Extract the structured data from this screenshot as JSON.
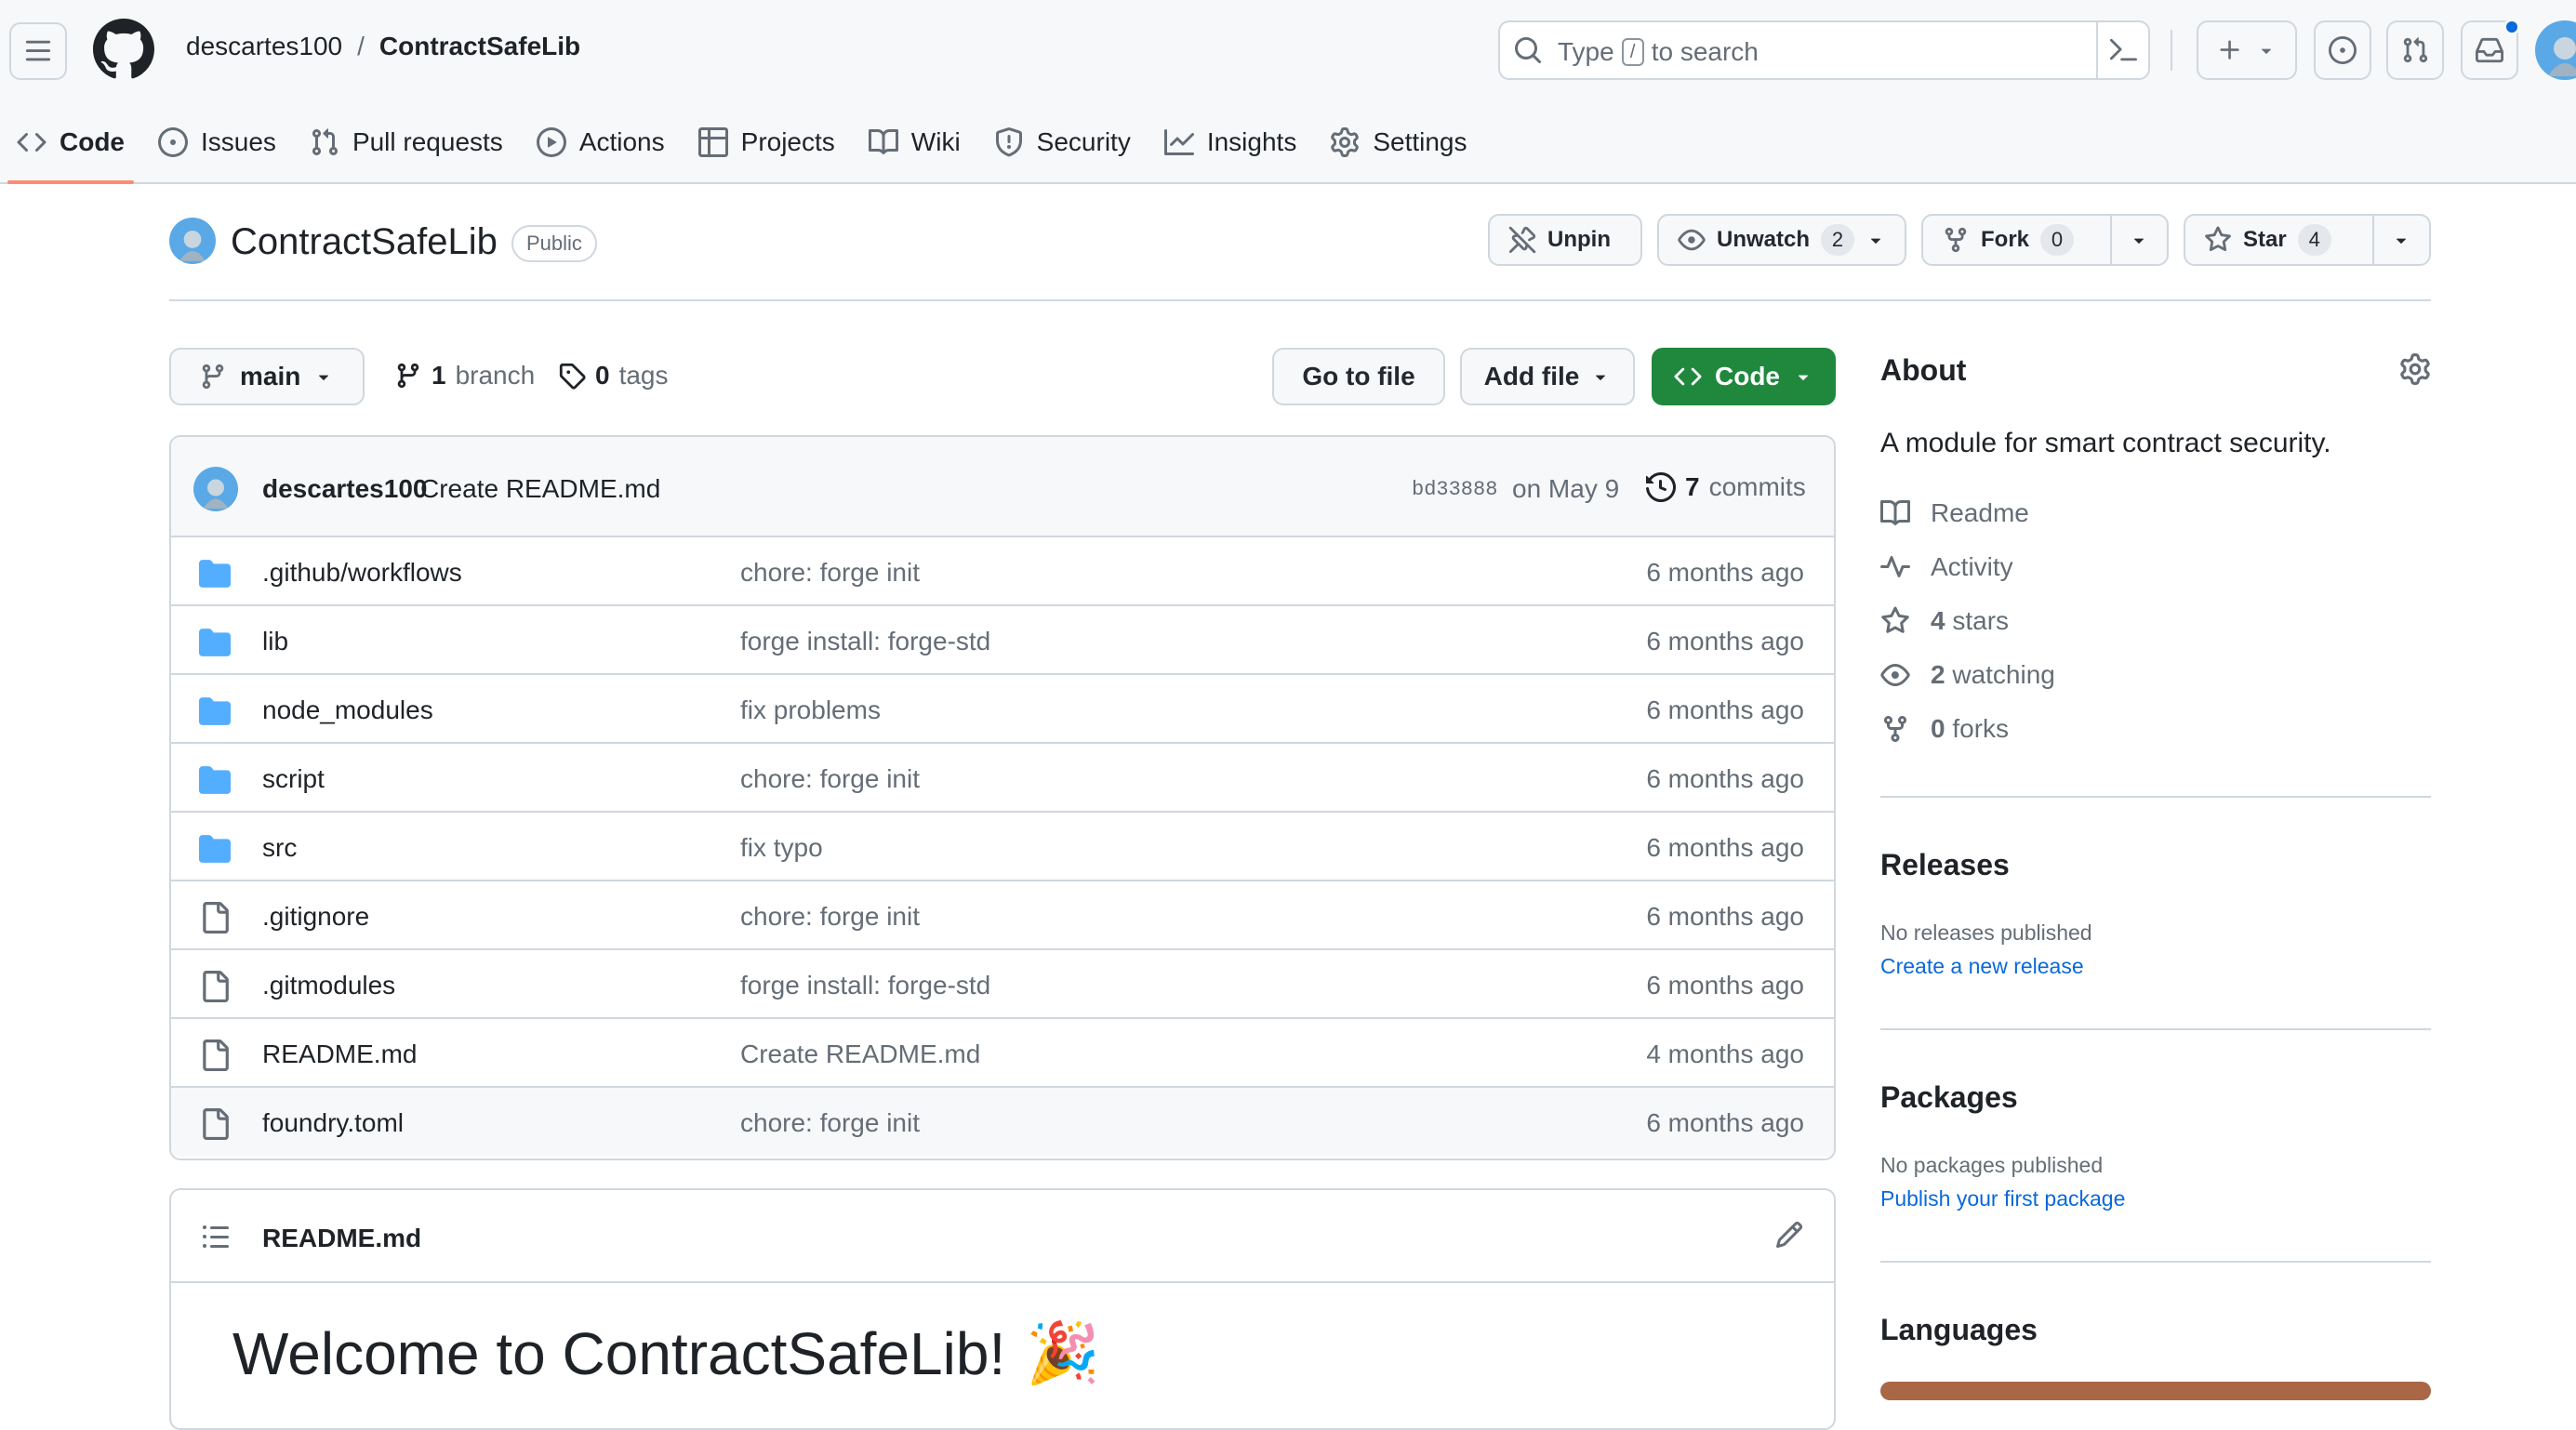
{
  "header": {
    "owner": "descartes100",
    "separator": "/",
    "repo": "ContractSafeLib",
    "search_prefix": "Type",
    "search_key": "/",
    "search_suffix": "to search"
  },
  "tabs": [
    {
      "label": "Code",
      "icon": "code-icon",
      "active": true
    },
    {
      "label": "Issues",
      "icon": "issue-opened-icon"
    },
    {
      "label": "Pull requests",
      "icon": "git-pull-request-icon"
    },
    {
      "label": "Actions",
      "icon": "play-icon"
    },
    {
      "label": "Projects",
      "icon": "table-icon"
    },
    {
      "label": "Wiki",
      "icon": "book-icon"
    },
    {
      "label": "Security",
      "icon": "shield-icon"
    },
    {
      "label": "Insights",
      "icon": "graph-icon"
    },
    {
      "label": "Settings",
      "icon": "gear-icon"
    }
  ],
  "repo": {
    "title": "ContractSafeLib",
    "visibility": "Public",
    "unpin_label": "Unpin",
    "watch_label": "Unwatch",
    "watch_count": "2",
    "fork_label": "Fork",
    "fork_count": "0",
    "star_label": "Star",
    "star_count": "4"
  },
  "branchbar": {
    "branch": "main",
    "branch_count": "1",
    "branch_word": "branch",
    "tag_count": "0",
    "tag_word": "tags",
    "goto_label": "Go to file",
    "addfile_label": "Add file",
    "code_label": "Code"
  },
  "commit": {
    "author": "descartes100",
    "message": "Create README.md",
    "hash": "bd33888",
    "date": "on May 9",
    "count": "7",
    "count_word": "commits"
  },
  "files": [
    {
      "type": "dir",
      "name": ".github/workflows",
      "message": "chore: forge init",
      "age": "6 months ago"
    },
    {
      "type": "dir",
      "name": "lib",
      "message": "forge install: forge-std",
      "age": "6 months ago"
    },
    {
      "type": "dir",
      "name": "node_modules",
      "message": "fix problems",
      "age": "6 months ago"
    },
    {
      "type": "dir",
      "name": "script",
      "message": "chore: forge init",
      "age": "6 months ago"
    },
    {
      "type": "dir",
      "name": "src",
      "message": "fix typo",
      "age": "6 months ago"
    },
    {
      "type": "file",
      "name": ".gitignore",
      "message": "chore: forge init",
      "age": "6 months ago"
    },
    {
      "type": "file",
      "name": ".gitmodules",
      "message": "forge install: forge-std",
      "age": "6 months ago"
    },
    {
      "type": "file",
      "name": "README.md",
      "message": "Create README.md",
      "age": "4 months ago"
    },
    {
      "type": "file",
      "name": "foundry.toml",
      "message": "chore: forge init",
      "age": "6 months ago"
    }
  ],
  "readme": {
    "filename": "README.md",
    "heading": "Welcome to ContractSafeLib!",
    "emoji": "🎉"
  },
  "about": {
    "title": "About",
    "description": "A module for smart contract security.",
    "items": [
      {
        "icon": "book-icon",
        "count": "",
        "label": "Readme"
      },
      {
        "icon": "pulse-icon",
        "count": "",
        "label": "Activity"
      },
      {
        "icon": "star-icon",
        "count": "4",
        "label": "stars"
      },
      {
        "icon": "eye-icon",
        "count": "2",
        "label": "watching"
      },
      {
        "icon": "repo-forked-icon",
        "count": "0",
        "label": "forks"
      }
    ]
  },
  "releases": {
    "title": "Releases",
    "empty": "No releases published",
    "link": "Create a new release"
  },
  "packages": {
    "title": "Packages",
    "empty": "No packages published",
    "link": "Publish your first package"
  },
  "languages": {
    "title": "Languages",
    "bar_color": "#aa6746"
  },
  "colors": {
    "accent_blue": "#0969da",
    "code_button_green": "#1f883d",
    "tab_underline": "#fd8c73",
    "folder_blue": "#54aeff"
  }
}
